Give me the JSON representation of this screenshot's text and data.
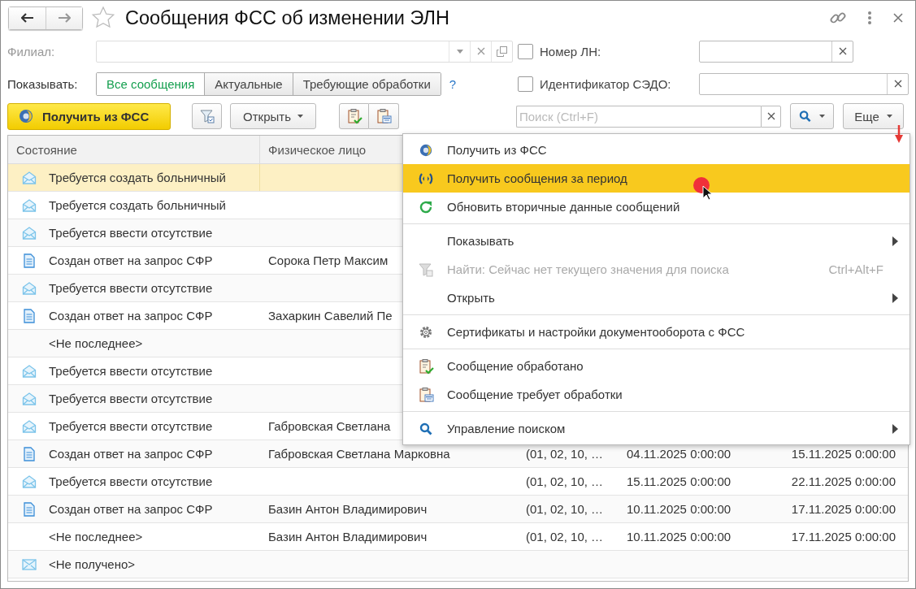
{
  "window": {
    "title": "Сообщения ФСС об изменении ЭЛН",
    "favorite": false
  },
  "branch": {
    "label": "Филиал:",
    "disabled": true
  },
  "show": {
    "label": "Показывать:",
    "help": "?",
    "options": [
      {
        "label": "Все сообщения",
        "selected": true
      },
      {
        "label": "Актуальные",
        "selected": false
      },
      {
        "label": "Требующие обработки",
        "selected": false
      }
    ]
  },
  "checks": [
    {
      "label": "Номер ЛН:",
      "checked": false
    },
    {
      "label": "Идентификатор СЭДО:",
      "checked": false
    }
  ],
  "toolbar": {
    "primary": "Получить из ФСС",
    "open": "Открыть",
    "search_placeholder": "Поиск (Ctrl+F)",
    "more": "Еще"
  },
  "table": {
    "columns": [
      "Состояние",
      "Физическое лицо"
    ],
    "rows": [
      {
        "kind": "request",
        "state": "Требуется создать больничный",
        "selected": true
      },
      {
        "kind": "request",
        "state": "Требуется создать больничный",
        "selected": false
      },
      {
        "kind": "request",
        "state": "Требуется ввести отсутствие",
        "selected": false
      },
      {
        "kind": "response",
        "state": "Создан ответ на запрос СФР",
        "person": "Сорока Петр Максим",
        "selected": false
      },
      {
        "kind": "request",
        "state": "Требуется ввести отсутствие",
        "selected": false
      },
      {
        "kind": "response",
        "state": "Создан ответ на запрос СФР",
        "person": "Захаркин Савелий Пе",
        "selected": false
      },
      {
        "kind": "plain",
        "state": "<Не последнее>",
        "selected": false
      },
      {
        "kind": "request",
        "state": "Требуется ввести отсутствие",
        "selected": false
      },
      {
        "kind": "request",
        "state": "Требуется ввести отсутствие",
        "selected": false
      },
      {
        "kind": "request",
        "state": "Требуется ввести отсутствие",
        "person": "Габровская Светлана",
        "selected": false
      },
      {
        "kind": "response",
        "state": "Создан ответ на запрос СФР",
        "person": "Габровская Светлана Марковна",
        "codes": "(01, 02, 10, …",
        "start": "04.11.2025 0:00:00",
        "end": "15.11.2025 0:00:00",
        "selected": false
      },
      {
        "kind": "request",
        "state": "Требуется ввести отсутствие",
        "codes": "(01, 02, 10, …",
        "start": "15.11.2025 0:00:00",
        "end": "22.11.2025 0:00:00",
        "selected": false
      },
      {
        "kind": "response",
        "state": "Создан ответ на запрос СФР",
        "person": "Базин Антон Владимирович",
        "codes": "(01, 02, 10, …",
        "start": "10.11.2025 0:00:00",
        "end": "17.11.2025 0:00:00",
        "selected": false
      },
      {
        "kind": "plain",
        "state": "<Не последнее>",
        "person": "Базин Антон Владимирович",
        "codes": "(01, 02, 10, …",
        "start": "10.11.2025 0:00:00",
        "end": "17.11.2025 0:00:00",
        "selected": false
      },
      {
        "kind": "unreceived",
        "state": "<Не получено>",
        "selected": false
      }
    ]
  },
  "menu": [
    {
      "kind": "fetch",
      "label": "Получить из ФСС",
      "selected": false,
      "disabled": false,
      "submenu": false
    },
    {
      "kind": "period",
      "label": "Получить сообщения за период",
      "selected": true,
      "disabled": false,
      "submenu": false
    },
    {
      "kind": "refresh",
      "label": "Обновить вторичные данные сообщений",
      "selected": false,
      "disabled": false,
      "submenu": false
    },
    {
      "kind": "separator"
    },
    {
      "kind": "plain",
      "label": "Показывать",
      "selected": false,
      "disabled": false,
      "submenu": true
    },
    {
      "kind": "find",
      "label": "Найти: Сейчас нет текущего значения для поиска",
      "shortcut": "Ctrl+Alt+F",
      "selected": false,
      "disabled": true,
      "submenu": false
    },
    {
      "kind": "plain",
      "label": "Открыть",
      "selected": false,
      "disabled": false,
      "submenu": true
    },
    {
      "kind": "separator"
    },
    {
      "kind": "settings",
      "label": "Сертификаты и настройки документооборота с ФСС",
      "selected": false,
      "disabled": false,
      "submenu": false
    },
    {
      "kind": "separator"
    },
    {
      "kind": "processed",
      "label": "Сообщение обработано",
      "selected": false,
      "disabled": false,
      "submenu": false
    },
    {
      "kind": "pending",
      "label": "Сообщение требует обработки",
      "selected": false,
      "disabled": false,
      "submenu": false
    },
    {
      "kind": "separator"
    },
    {
      "kind": "search",
      "label": "Управление поиском",
      "selected": false,
      "disabled": false,
      "submenu": true
    }
  ]
}
